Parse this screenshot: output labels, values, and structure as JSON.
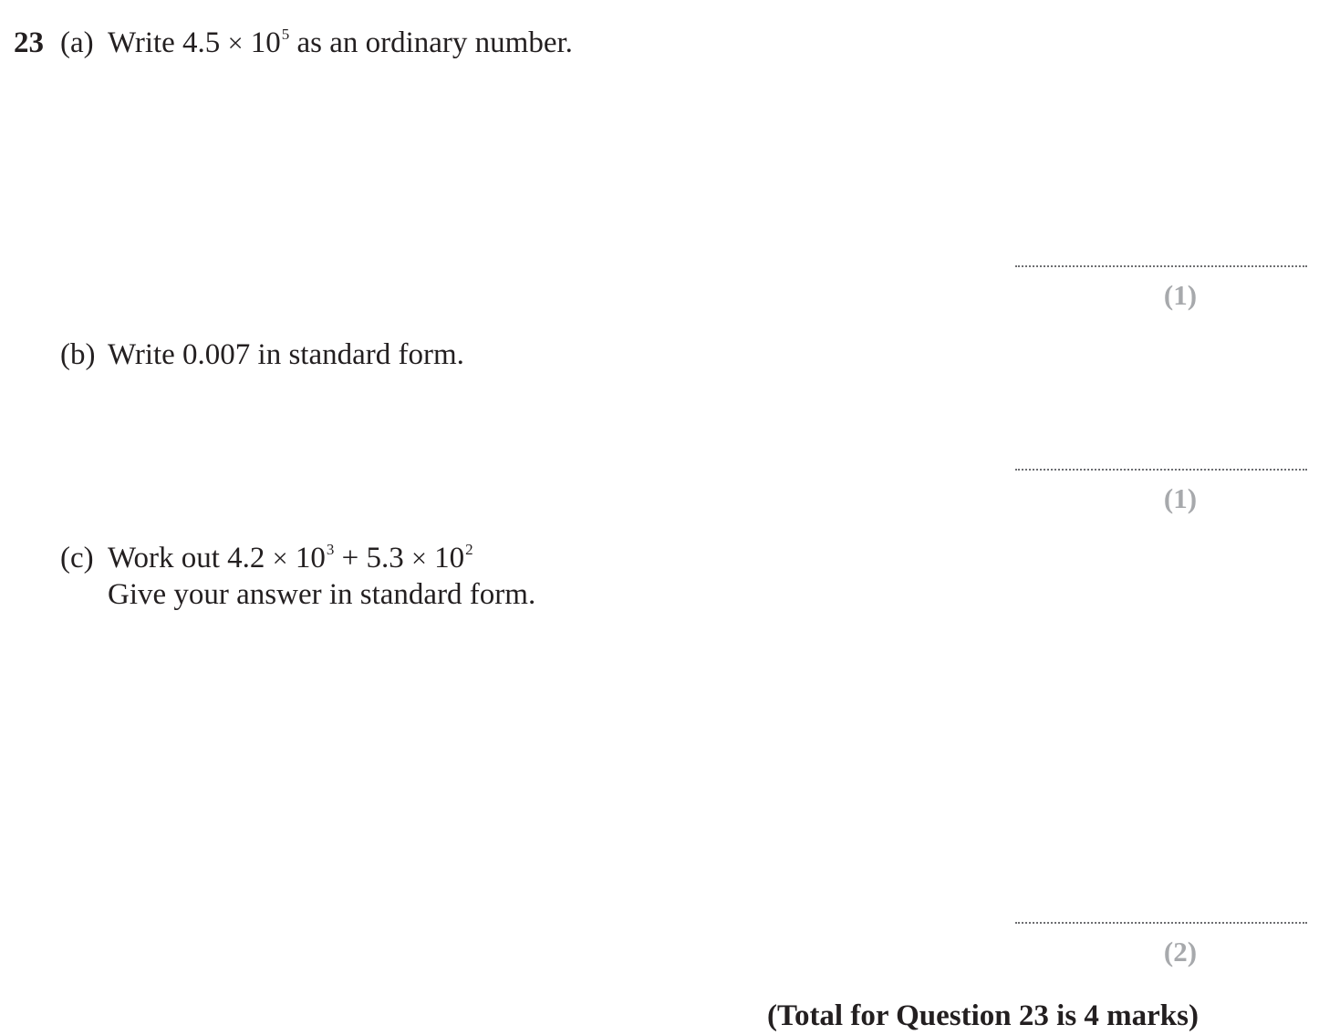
{
  "question": {
    "number": "23",
    "part_a": {
      "label": "(a)",
      "text_before": "Write 4.5",
      "times": "×",
      "base": "10",
      "exponent": "5",
      "text_after": "as an ordinary number.",
      "marks": "(1)"
    },
    "part_b": {
      "label": "(b)",
      "text": "Write 0.007 in standard form.",
      "marks": "(1)"
    },
    "part_c": {
      "label": "(c)",
      "text_prefix": "Work out 4.2",
      "times": "×",
      "base1": "10",
      "exp1": "3",
      "plus_part": "+ 5.3",
      "base2": "10",
      "exp2": "2",
      "line2": "Give your answer in standard form.",
      "marks": "(2)"
    },
    "total": "(Total for Question 23 is 4 marks)"
  }
}
